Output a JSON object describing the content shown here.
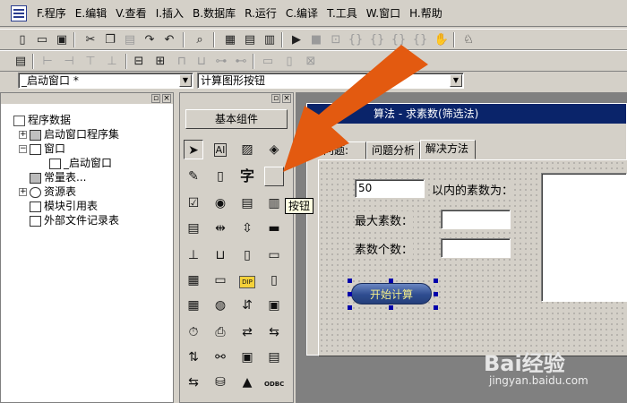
{
  "menubar": {
    "items": [
      "F.程序",
      "E.编辑",
      "V.查看",
      "I.插入",
      "B.数据库",
      "R.运行",
      "C.编译",
      "T.工具",
      "W.窗口",
      "H.帮助"
    ]
  },
  "combos": {
    "window_select": "_启动窗口 *",
    "component_select": "计算图形按钮"
  },
  "tree": {
    "items": [
      {
        "label": "程序数据",
        "icon": "program-data-icon"
      },
      {
        "label": "启动窗口程序集",
        "icon": "assembly-icon"
      },
      {
        "label": "窗口",
        "icon": "window-folder-icon"
      },
      {
        "label": "_启动窗口",
        "icon": "window-icon"
      },
      {
        "label": "常量表...",
        "icon": "constant-table-icon"
      },
      {
        "label": "资源表",
        "icon": "resource-table-icon"
      },
      {
        "label": "模块引用表",
        "icon": "module-ref-icon"
      },
      {
        "label": "外部文件记录表",
        "icon": "external-file-icon"
      }
    ]
  },
  "palette": {
    "title": "基本组件",
    "label_tool_text": "AI",
    "char_tool_text": "字",
    "scroll_tool_text": "DIP",
    "odbc_tool_text": "ODBC"
  },
  "tooltip": "按钮",
  "designer": {
    "form_title": "算法 - 求素数(筛选法)",
    "tabs": [
      "问题:",
      "问题分析",
      "解决方法"
    ],
    "input_value": "50",
    "label_within": "以内的素数为：",
    "label_max": "最大素数：",
    "label_count": "素数个数：",
    "button_label": "开始计算"
  },
  "watermark": {
    "brand": "Bai经验",
    "url": "jingyan.baidu.com"
  },
  "colors": {
    "arrow": "#e35a10",
    "title_bar": "#0a246a",
    "button_text": "#f6f08a"
  }
}
